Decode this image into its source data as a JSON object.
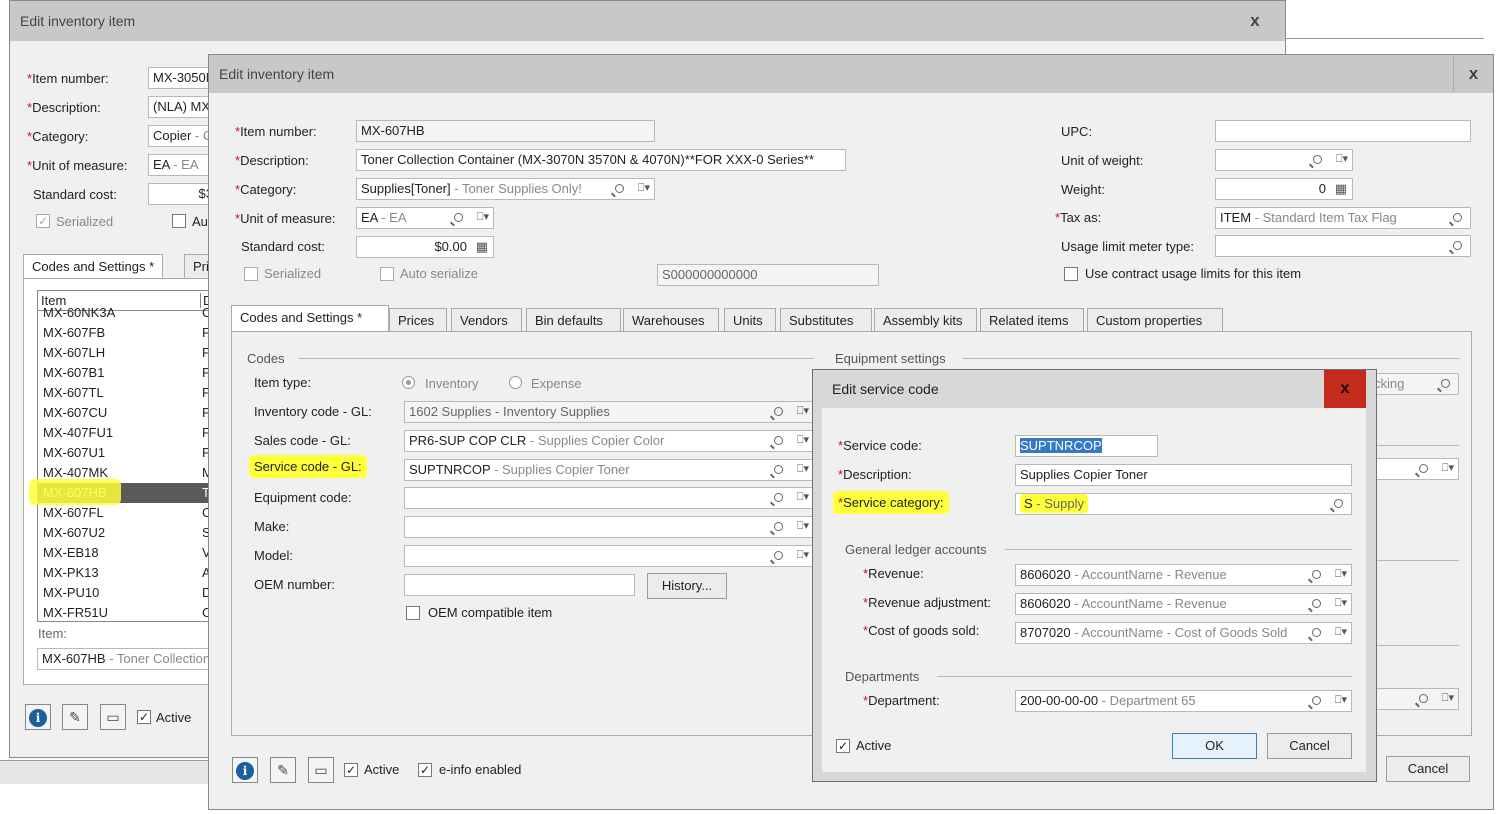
{
  "back_window": {
    "title": "Edit inventory item",
    "close": "x",
    "labels": {
      "item_number": "Item number:",
      "description": "Description:",
      "category": "Category:",
      "unit": "Unit of measure:",
      "std_cost": "Standard cost:",
      "serialized": "Serialized",
      "auto": "Au"
    },
    "values": {
      "item_number": "MX-3050N",
      "description": "(NLA) MX-",
      "category_code": "Copier",
      "category_desc": " - C",
      "unit_code": "EA",
      "unit_desc": " - EA",
      "std_cost": "$3"
    },
    "tabs": [
      "Codes and Settings *",
      "Pri"
    ],
    "list_header": [
      "Item",
      "D"
    ],
    "list_items": [
      {
        "item": "MX-60NK3A",
        "d": "C"
      },
      {
        "item": "MX-607FB",
        "d": "F"
      },
      {
        "item": "MX-607LH",
        "d": "P"
      },
      {
        "item": "MX-607B1",
        "d": "P"
      },
      {
        "item": "MX-607TL",
        "d": "P"
      },
      {
        "item": "MX-607CU",
        "d": "P"
      },
      {
        "item": "MX-407FU1",
        "d": "F"
      },
      {
        "item": "MX-607U1",
        "d": "P"
      },
      {
        "item": "MX-407MK",
        "d": "M"
      },
      {
        "item": "MX-607HB",
        "d": "T"
      },
      {
        "item": "MX-607FL",
        "d": "C"
      },
      {
        "item": "MX-607U2",
        "d": "S"
      },
      {
        "item": "MX-EB18",
        "d": "V"
      },
      {
        "item": "MX-PK13",
        "d": "A"
      },
      {
        "item": "MX-PU10",
        "d": "D"
      },
      {
        "item": "MX-FR51U",
        "d": "C"
      }
    ],
    "item_label": "Item:",
    "item_value_code": "MX-607HB",
    "item_value_desc": " - Toner Collection",
    "active": "Active"
  },
  "main_window": {
    "title": "Edit inventory item",
    "close": "x",
    "labels": {
      "item_number": "Item number:",
      "description": "Description:",
      "category": "Category:",
      "unit": "Unit of measure:",
      "std_cost": "Standard cost:",
      "serialized": "Serialized",
      "auto_serialize": "Auto serialize",
      "upc": "UPC:",
      "unit_weight": "Unit of weight:",
      "weight": "Weight:",
      "tax_as": "Tax as:",
      "usage_limit": "Usage limit meter type:",
      "use_contract": "Use contract usage limits for this item"
    },
    "values": {
      "item_number": "MX-607HB",
      "description": "Toner Collection Container  (MX-3070N 3570N & 4070N)**FOR XXX-0 Series**",
      "category_code": "Supplies[Toner]",
      "category_desc": " - Toner Supplies Only!",
      "unit_code": "EA",
      "unit_desc": " - EA",
      "std_cost": "$0.00",
      "serial": "S000000000000",
      "upc": "",
      "unit_weight": "",
      "weight": "0",
      "tax_code": "ITEM",
      "tax_desc": " - Standard Item Tax Flag",
      "usage_limit": ""
    },
    "tabs": [
      "Codes and Settings *",
      "Prices",
      "Vendors",
      "Bin defaults",
      "Warehouses",
      "Units",
      "Substitutes",
      "Assembly kits",
      "Related items",
      "Custom properties"
    ],
    "codes": {
      "group": "Codes",
      "item_type": "Item type:",
      "inventory": "Inventory",
      "expense": "Expense",
      "inventory_gl": "Inventory code - GL:",
      "inventory_gl_code": "1602 Supplies",
      "inventory_gl_desc": " - Inventory Supplies",
      "sales_gl": "Sales code - GL:",
      "sales_gl_code": "PR6-SUP COP CLR",
      "sales_gl_desc": " - Supplies Copier Color",
      "service_gl": "Service code - GL:",
      "service_gl_code": "SUPTNRCOP",
      "service_gl_desc": " - Supplies Copier Toner",
      "equipment_code": "Equipment code:",
      "make": "Make:",
      "model": "Model:",
      "oem_number": "OEM number:",
      "history": "History...",
      "oem_compatible": "OEM compatible item"
    },
    "equipment_settings": "Equipment settings",
    "equipment_partial": "cking",
    "active": "Active",
    "einfo": "e-info enabled",
    "cancel": "Cancel"
  },
  "dialog": {
    "title": "Edit service code",
    "close": "x",
    "service_code_label": "Service code:",
    "service_code": "SUPTNRCOP",
    "description_label": "Description:",
    "description": "Supplies Copier Toner",
    "service_category_label": "Service category:",
    "service_category_code": "S",
    "service_category_desc": " - Supply",
    "gl_group": "General ledger accounts",
    "revenue_label": "Revenue:",
    "revenue_code": "8606020",
    "revenue_desc": " - AccountName - Revenue",
    "rev_adj_label": "Revenue adjustment:",
    "rev_adj_code": "8606020",
    "rev_adj_desc": " - AccountName - Revenue",
    "cogs_label": "Cost of goods sold:",
    "cogs_code": "8707020",
    "cogs_desc": " - AccountName - Cost of Goods Sold",
    "departments_group": "Departments",
    "department_label": "Department:",
    "department_code": "200-00-00-00",
    "department_desc": " - Department 65",
    "active": "Active",
    "ok": "OK",
    "cancel": "Cancel"
  },
  "colors": {
    "highlight": "#ffff3a",
    "required": "#d01010",
    "close_red": "#c42b1c",
    "selected_row": "#5a5a5a"
  }
}
